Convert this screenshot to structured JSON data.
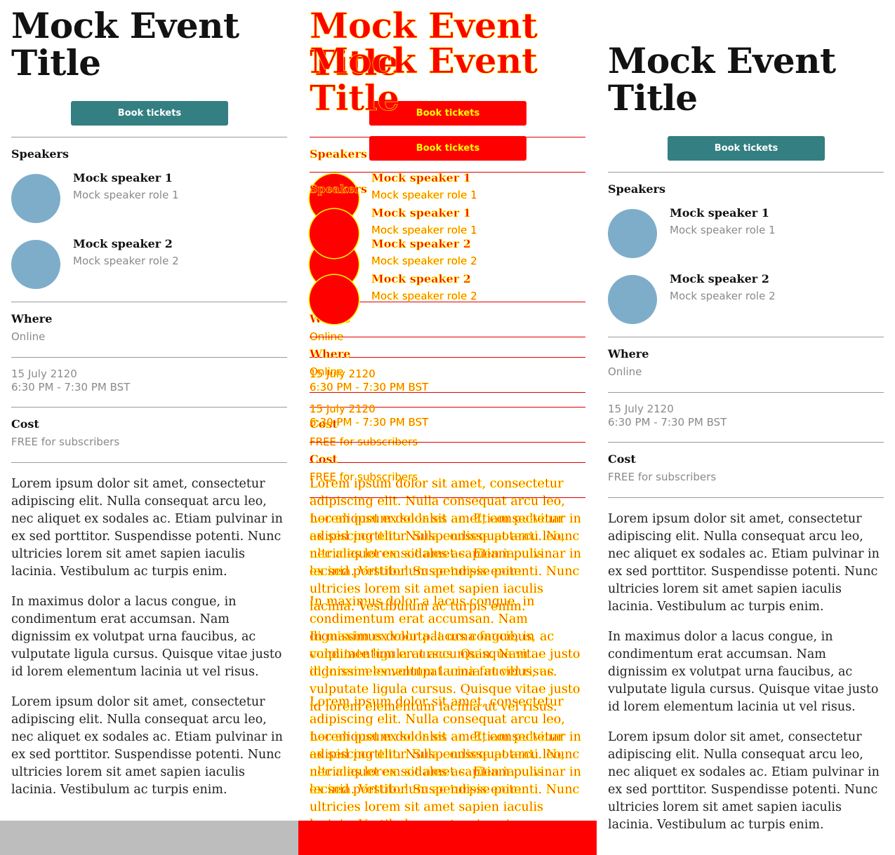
{
  "event": {
    "title": "Mock Event Title",
    "book_label": "Book tickets"
  },
  "speakers": {
    "heading": "Speakers",
    "items": [
      {
        "name": "Mock speaker 1",
        "role": "Mock speaker role 1"
      },
      {
        "name": "Mock speaker 2",
        "role": "Mock speaker role 2"
      }
    ]
  },
  "where": {
    "heading": "Where",
    "value": "Online"
  },
  "when": {
    "date": "15 July 2120",
    "time": "6:30 PM - 7:30 PM BST"
  },
  "cost": {
    "heading": "Cost",
    "value": "FREE for subscribers"
  },
  "body": [
    "Lorem ipsum dolor sit amet, consectetur adipiscing elit. Nulla consequat arcu leo, nec aliquet ex sodales ac. Etiam pulvinar in ex sed porttitor. Suspendisse potenti. Nunc ultricies lorem sit amet sapien iaculis lacinia. Vestibulum ac turpis enim.",
    "In maximus dolor a lacus congue, in condimentum erat accumsan. Nam dignissim ex volutpat urna faucibus, ac vulputate ligula cursus. Quisque vitae justo id lorem elementum lacinia ut vel risus.",
    "Lorem ipsum dolor sit amet, consectetur adipiscing elit. Nulla consequat arcu leo, nec aliquet ex sodales ac. Etiam pulvinar in ex sed porttitor. Suspendisse potenti. Nunc ultricies lorem sit amet sapien iaculis lacinia. Vestibulum ac turpis enim."
  ],
  "colors": {
    "button": "#337f82",
    "avatar": "#7eadca",
    "diff_fill": "#ff0000",
    "diff_outline": "#ffff00"
  }
}
